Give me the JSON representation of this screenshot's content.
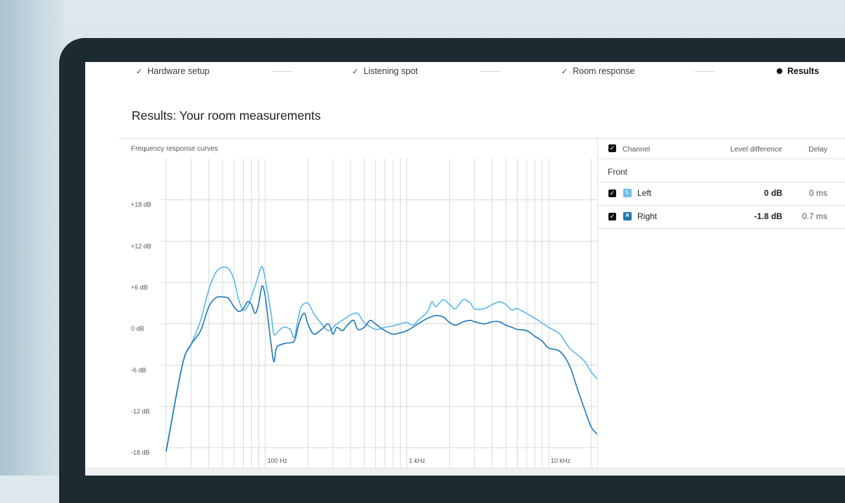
{
  "stepper": {
    "steps": [
      {
        "label": "Hardware setup",
        "state": "done",
        "icon": "check-icon"
      },
      {
        "label": "Listening spot",
        "state": "done",
        "icon": "check-icon"
      },
      {
        "label": "Room response",
        "state": "done",
        "icon": "check-icon"
      },
      {
        "label": "Results",
        "state": "active",
        "icon": "dot-icon"
      }
    ]
  },
  "page": {
    "title": "Results: Your room measurements"
  },
  "chart_panel": {
    "title": "Frequency response curves"
  },
  "chart_data": {
    "type": "line",
    "title": "Frequency response curves",
    "x_scale": "log",
    "x_unit": "Hz",
    "xlim": [
      20,
      22000
    ],
    "x_tick_labels": [
      {
        "value": 100,
        "label": "100 Hz"
      },
      {
        "value": 1000,
        "label": "1 kHz"
      },
      {
        "value": 10000,
        "label": "10 kHz"
      }
    ],
    "y_unit": "dB",
    "ylim": [
      -21,
      24
    ],
    "y_tick_labels": [
      {
        "value": 18,
        "label": "+18 dB"
      },
      {
        "value": 12,
        "label": "+12 dB"
      },
      {
        "value": 6,
        "label": "+6 dB"
      },
      {
        "value": 0,
        "label": "0 dB"
      },
      {
        "value": -6,
        "label": "-6 dB"
      },
      {
        "value": -12,
        "label": "-12 dB"
      },
      {
        "value": -18,
        "label": "-18 dB"
      }
    ],
    "grid": true,
    "series": [
      {
        "name": "Left",
        "color": "#5cb7ea",
        "points": [
          [
            20,
            -18.5
          ],
          [
            26,
            -6
          ],
          [
            30,
            -3
          ],
          [
            35,
            0.5
          ],
          [
            40,
            5
          ],
          [
            45,
            7.5
          ],
          [
            50,
            8.2
          ],
          [
            55,
            8.0
          ],
          [
            60,
            6.5
          ],
          [
            65,
            3.5
          ],
          [
            70,
            2.0
          ],
          [
            75,
            2.5
          ],
          [
            80,
            4.0
          ],
          [
            85,
            5.5
          ],
          [
            90,
            7.2
          ],
          [
            95,
            8.3
          ],
          [
            100,
            6.5
          ],
          [
            110,
            1.5
          ],
          [
            115,
            -1.5
          ],
          [
            125,
            -1.0
          ],
          [
            135,
            -0.5
          ],
          [
            150,
            -0.8
          ],
          [
            160,
            -2.0
          ],
          [
            170,
            0.5
          ],
          [
            180,
            2.5
          ],
          [
            200,
            3.0
          ],
          [
            220,
            1.5
          ],
          [
            250,
            0
          ],
          [
            280,
            -1.0
          ],
          [
            320,
            0
          ],
          [
            350,
            0.5
          ],
          [
            400,
            1.3
          ],
          [
            450,
            1.5
          ],
          [
            500,
            0.2
          ],
          [
            600,
            -0.8
          ],
          [
            700,
            -0.5
          ],
          [
            800,
            -0.3
          ],
          [
            900,
            0
          ],
          [
            1000,
            0.2
          ],
          [
            1100,
            -0.2
          ],
          [
            1200,
            0.5
          ],
          [
            1400,
            1.8
          ],
          [
            1500,
            3.2
          ],
          [
            1600,
            2.5
          ],
          [
            1800,
            3.5
          ],
          [
            2000,
            2.8
          ],
          [
            2200,
            2.2
          ],
          [
            2500,
            3.5
          ],
          [
            2800,
            3.0
          ],
          [
            3000,
            2.2
          ],
          [
            3500,
            2.2
          ],
          [
            4000,
            2.8
          ],
          [
            4500,
            3.2
          ],
          [
            5000,
            2.8
          ],
          [
            5500,
            2.0
          ],
          [
            6000,
            2.2
          ],
          [
            7000,
            1.5
          ],
          [
            8000,
            0.8
          ],
          [
            10000,
            -0.5
          ],
          [
            12000,
            -1.5
          ],
          [
            14000,
            -3.5
          ],
          [
            16000,
            -4.5
          ],
          [
            18000,
            -5.5
          ],
          [
            20000,
            -7.0
          ],
          [
            22000,
            -8.0
          ]
        ]
      },
      {
        "name": "Right",
        "color": "#1f78b4",
        "points": [
          [
            20,
            -18.5
          ],
          [
            26,
            -6
          ],
          [
            30,
            -3
          ],
          [
            35,
            -1
          ],
          [
            40,
            2.5
          ],
          [
            45,
            3.8
          ],
          [
            50,
            3.9
          ],
          [
            55,
            3.7
          ],
          [
            60,
            2.5
          ],
          [
            65,
            1.8
          ],
          [
            70,
            2.2
          ],
          [
            75,
            3.2
          ],
          [
            80,
            2.8
          ],
          [
            85,
            1.5
          ],
          [
            90,
            3.0
          ],
          [
            95,
            5.5
          ],
          [
            100,
            4.0
          ],
          [
            105,
            0.5
          ],
          [
            110,
            -3.0
          ],
          [
            115,
            -5.5
          ],
          [
            120,
            -3.5
          ],
          [
            130,
            -3.0
          ],
          [
            140,
            -2.8
          ],
          [
            160,
            -2.5
          ],
          [
            170,
            -0.5
          ],
          [
            180,
            1.0
          ],
          [
            190,
            1.5
          ],
          [
            200,
            0
          ],
          [
            220,
            -1.5
          ],
          [
            250,
            -0.8
          ],
          [
            280,
            0
          ],
          [
            300,
            -1.5
          ],
          [
            320,
            -0.5
          ],
          [
            350,
            -1.0
          ],
          [
            380,
            -0.2
          ],
          [
            420,
            0.5
          ],
          [
            450,
            -0.8
          ],
          [
            500,
            -0.5
          ],
          [
            550,
            0.5
          ],
          [
            600,
            0
          ],
          [
            700,
            -1.0
          ],
          [
            800,
            -1.5
          ],
          [
            900,
            -1.3
          ],
          [
            1000,
            -1.0
          ],
          [
            1100,
            -0.5
          ],
          [
            1200,
            0
          ],
          [
            1400,
            0.8
          ],
          [
            1600,
            1.2
          ],
          [
            1800,
            1.0
          ],
          [
            2000,
            0.2
          ],
          [
            2200,
            -0.2
          ],
          [
            2500,
            0.3
          ],
          [
            2800,
            0.5
          ],
          [
            3000,
            0.3
          ],
          [
            3500,
            0
          ],
          [
            4000,
            0.3
          ],
          [
            4500,
            0.3
          ],
          [
            5000,
            -0.2
          ],
          [
            5500,
            -0.5
          ],
          [
            6000,
            -0.8
          ],
          [
            7000,
            -1.0
          ],
          [
            8000,
            -1.8
          ],
          [
            9000,
            -2.5
          ],
          [
            10000,
            -3.5
          ],
          [
            12000,
            -4.0
          ],
          [
            14000,
            -6.0
          ],
          [
            16000,
            -9.5
          ],
          [
            18000,
            -12.5
          ],
          [
            20000,
            -15.0
          ],
          [
            22000,
            -16.0
          ]
        ]
      }
    ]
  },
  "table": {
    "headers": {
      "channel": "Channel",
      "level": "Level difference",
      "delay": "Delay"
    },
    "group": "Front",
    "rows": [
      {
        "badge": "L",
        "name": "Left",
        "level": "0 dB",
        "delay": "0 ms",
        "color": "#6cc0ee",
        "checked": true
      },
      {
        "badge": "R",
        "name": "Right",
        "level": "-1.8 dB",
        "delay": "0.7 ms",
        "color": "#1f78b4",
        "checked": true
      }
    ]
  }
}
